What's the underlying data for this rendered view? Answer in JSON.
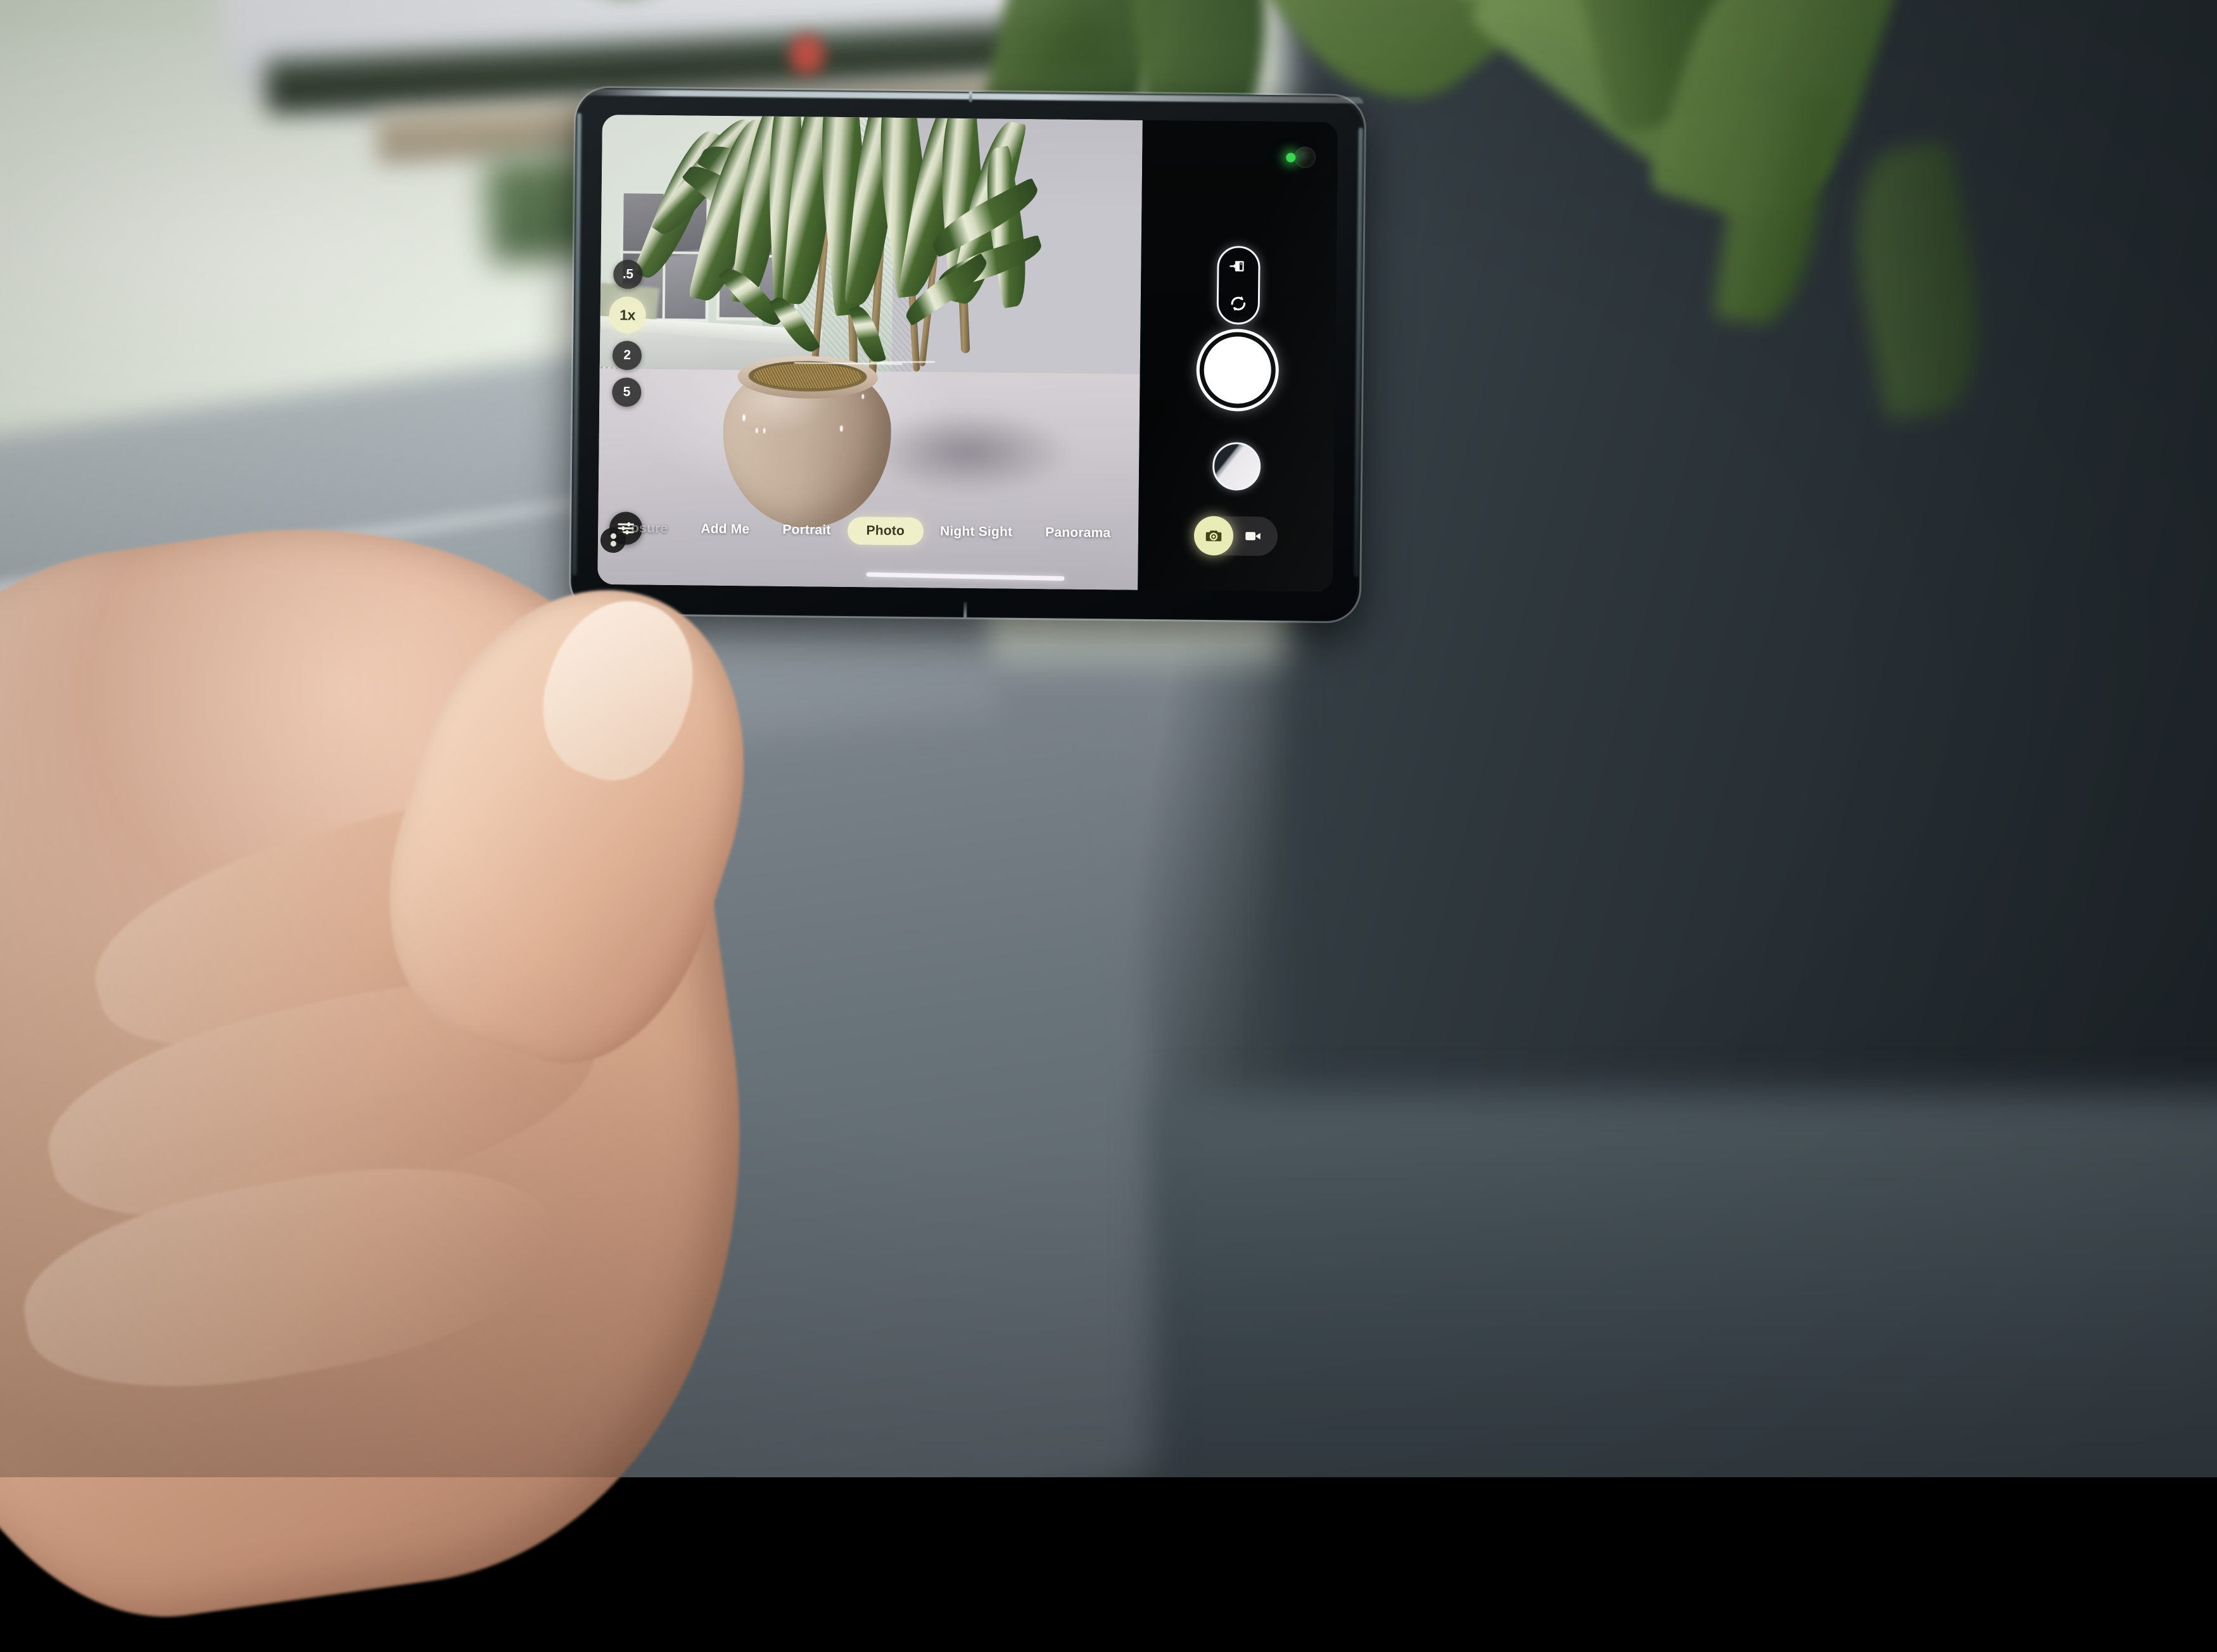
{
  "app": {
    "name": "Camera",
    "device_type": "foldable-phone-inner-display"
  },
  "status": {
    "privacy_indicator": "camera-in-use",
    "privacy_color": "#3ddc55"
  },
  "zoom_rail": {
    "label": "Zoom levels",
    "options": [
      {
        "label": ".5",
        "selected": false
      },
      {
        "label": "1x",
        "selected": true
      },
      {
        "label": "2",
        "selected": false
      },
      {
        "label": "5",
        "selected": false
      }
    ],
    "selected_value": "1x",
    "active_color": "#eff0c9"
  },
  "mode_carousel": {
    "modes": [
      {
        "label": "osure",
        "state": "cut-off"
      },
      {
        "label": "Add Me",
        "state": "normal"
      },
      {
        "label": "Portrait",
        "state": "normal"
      },
      {
        "label": "Photo",
        "state": "selected"
      },
      {
        "label": "Night Sight",
        "state": "normal"
      },
      {
        "label": "Panorama",
        "state": "normal"
      }
    ],
    "selected": "Photo",
    "selected_pill_color": "#eff0c9"
  },
  "controls": {
    "settings_icon": "tune-sliders-icon",
    "screen_transfer_icon": "move-to-other-screen-icon",
    "flip_camera_icon": "flip-camera-icon",
    "shutter_label": "Shutter",
    "gallery_label": "Last photo",
    "gesture_bar_label": "Navigation gesture bar"
  },
  "media_toggle": {
    "options": [
      {
        "label": "Photo",
        "icon": "camera-icon",
        "selected": true
      },
      {
        "label": "Video",
        "icon": "video-camera-icon",
        "selected": false
      }
    ],
    "active_color": "#e9ecb5"
  },
  "viewfinder": {
    "description": "Potted dracaena plant on a pale concrete ledge beside a window",
    "subject": "Dracaena in beige ceramic pot"
  },
  "scene": {
    "description": "Hand holding an unfolded foldable phone in front of a window overlooking water"
  }
}
